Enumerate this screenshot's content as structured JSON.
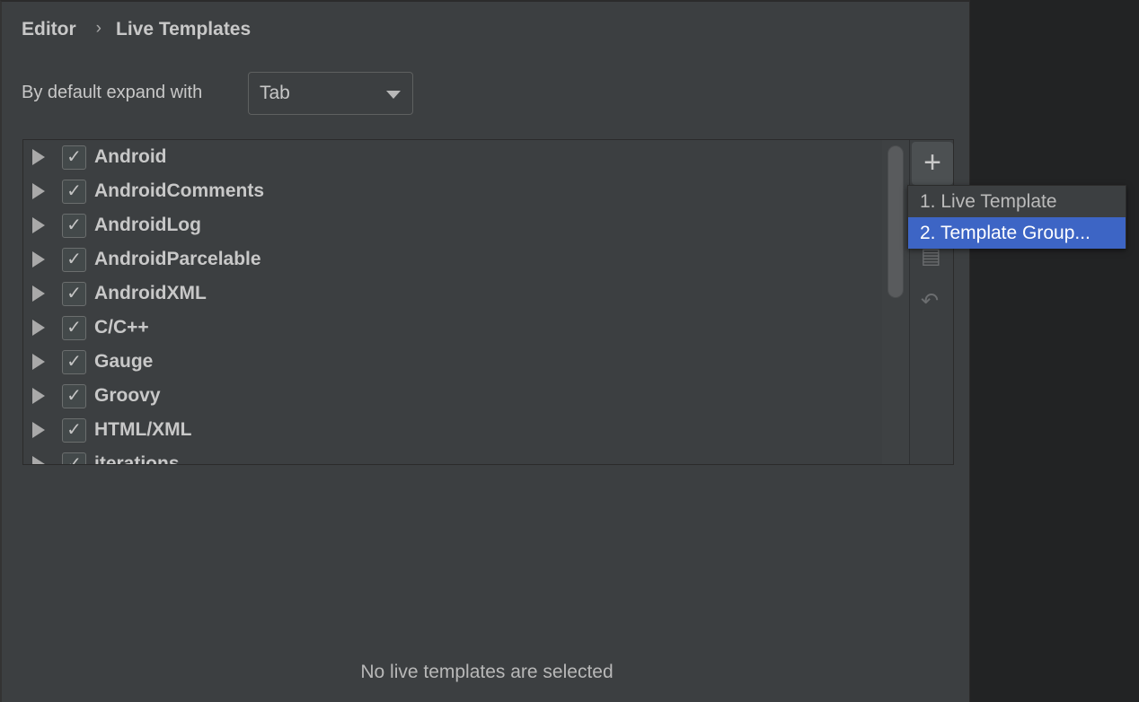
{
  "breadcrumb": {
    "parent": "Editor",
    "separator": "›",
    "current": "Live Templates"
  },
  "expand": {
    "label": "By default expand with",
    "value": "Tab"
  },
  "groups": [
    {
      "label": "Android",
      "checked": true
    },
    {
      "label": "AndroidComments",
      "checked": true
    },
    {
      "label": "AndroidLog",
      "checked": true
    },
    {
      "label": "AndroidParcelable",
      "checked": true
    },
    {
      "label": "AndroidXML",
      "checked": true
    },
    {
      "label": "C/C++",
      "checked": true
    },
    {
      "label": "Gauge",
      "checked": true
    },
    {
      "label": "Groovy",
      "checked": true
    },
    {
      "label": "HTML/XML",
      "checked": true
    },
    {
      "label": "iterations",
      "checked": true
    }
  ],
  "toolbar": {
    "add": "+",
    "copy_icon": "copy-icon",
    "revert_icon": "undo-icon"
  },
  "popup": {
    "items": [
      {
        "label": "1. Live Template",
        "selected": false
      },
      {
        "label": "2. Template Group...",
        "selected": true
      }
    ],
    "highlight": "#3d65c5"
  },
  "empty_message": "No live templates are selected"
}
